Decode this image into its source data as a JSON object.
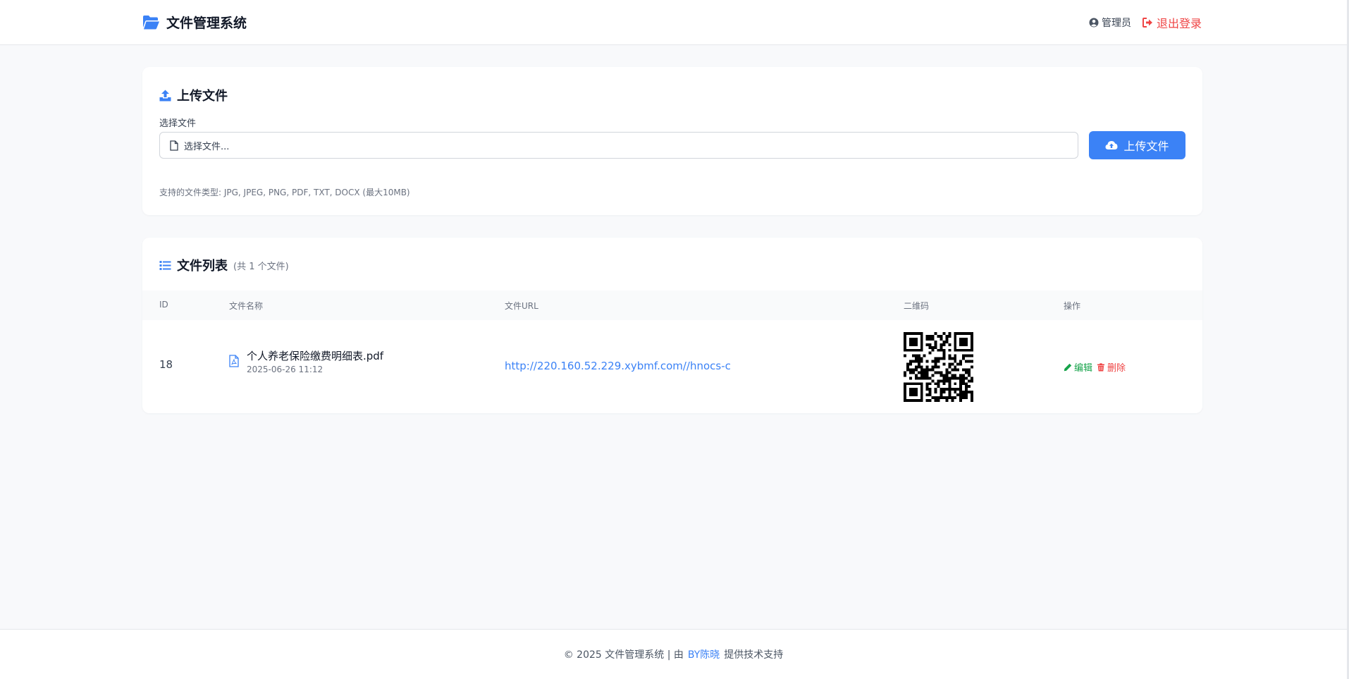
{
  "header": {
    "title": "文件管理系统",
    "user_label": "管理员",
    "logout_label": "退出登录"
  },
  "upload": {
    "title": "上传文件",
    "field_label": "选择文件",
    "placeholder": "选择文件...",
    "button_label": "上传文件",
    "hint": "支持的文件类型: JPG, JPEG, PNG, PDF, TXT, DOCX (最大10MB)"
  },
  "file_list": {
    "title": "文件列表",
    "count_text": "(共 1 个文件)",
    "columns": [
      "ID",
      "文件名称",
      "文件URL",
      "二维码",
      "操作"
    ],
    "rows": [
      {
        "id": "18",
        "name": "个人养老保险缴费明细表.pdf",
        "date": "2025-06-26 11:12",
        "url": "http://220.160.52.229.xybmf.com//hnocs-cep...",
        "edit_label": "编辑",
        "delete_label": "删除"
      }
    ]
  },
  "footer": {
    "copyright": "© 2025 文件管理系统 | 由",
    "credit": "BY陈晓",
    "suffix": "提供技术支持"
  },
  "colors": {
    "accent": "#3b82f6",
    "danger": "#ef4444",
    "success": "#16a34a",
    "background": "#f8f9fb"
  },
  "icons": {
    "brand": "folder-open-icon",
    "user": "user-circle-icon",
    "logout": "sign-out-icon",
    "upload_title": "upload-icon",
    "file_input": "file-icon",
    "upload_button": "cloud-upload-icon",
    "list_title": "list-icon",
    "file_row": "file-pdf-icon",
    "edit": "pencil-icon",
    "delete": "trash-icon",
    "qr": "qr-code-icon"
  }
}
